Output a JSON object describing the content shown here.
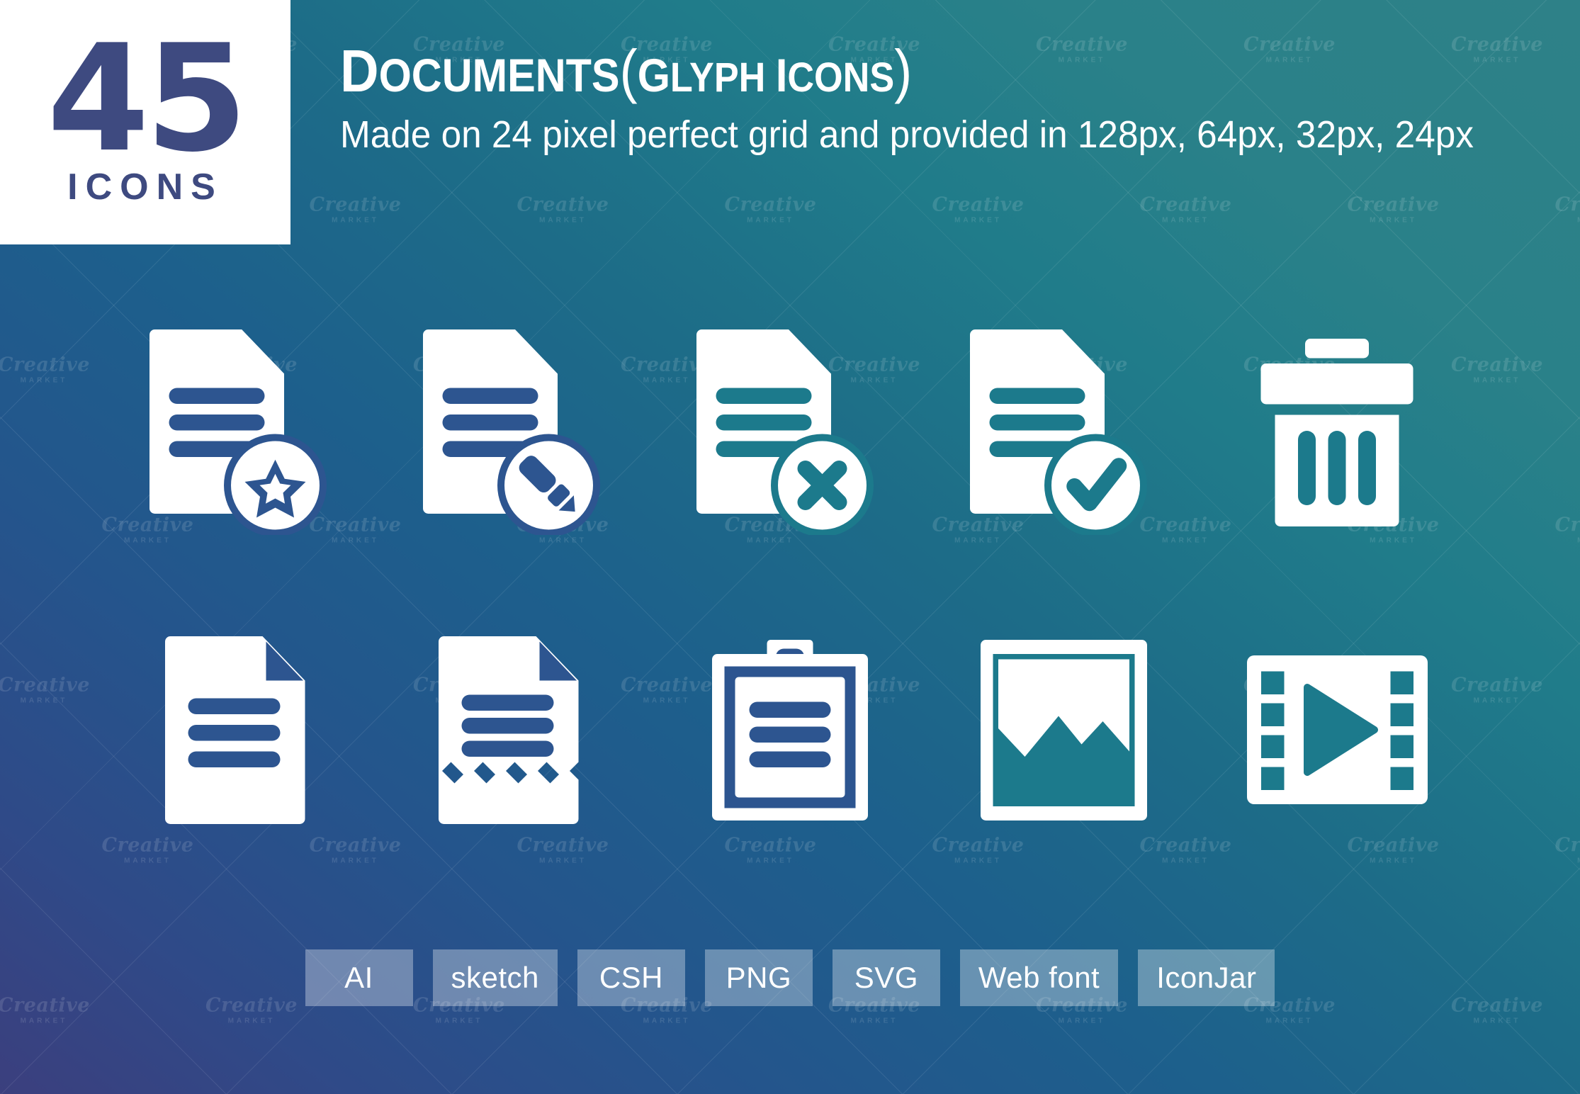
{
  "badge": {
    "count": "45",
    "word": "ICONS"
  },
  "header": {
    "title_lead": "D",
    "title_rest": "OCUMENTS",
    "title_paren_open": "(",
    "title_sub_lead": "G",
    "title_sub": "LYPH ",
    "title_sub_lead2": "I",
    "title_sub2": "CONS",
    "title_paren_close": ")",
    "title_plain": "Documents (Glyph Icons)",
    "subtitle": "Made on 24 pixel perfect grid and provided in 128px, 64px, 32px, 24px"
  },
  "icons": {
    "rows": [
      [
        {
          "name": "document-star-icon",
          "label": "Document Favorite"
        },
        {
          "name": "document-edit-icon",
          "label": "Document Edit"
        },
        {
          "name": "document-delete-icon",
          "label": "Document Remove"
        },
        {
          "name": "document-approved-icon",
          "label": "Document Approved"
        },
        {
          "name": "trash-bin-icon",
          "label": "Trash Bin"
        }
      ],
      [
        {
          "name": "document-plain-icon",
          "label": "Document"
        },
        {
          "name": "receipt-icon",
          "label": "Receipt"
        },
        {
          "name": "clipboard-icon",
          "label": "Clipboard"
        },
        {
          "name": "image-file-icon",
          "label": "Image File"
        },
        {
          "name": "video-file-icon",
          "label": "Video File"
        }
      ]
    ]
  },
  "formats": [
    {
      "label": "AI"
    },
    {
      "label": "sketch"
    },
    {
      "label": "CSH"
    },
    {
      "label": "PNG"
    },
    {
      "label": "SVG"
    },
    {
      "label": "Web font"
    },
    {
      "label": "IconJar"
    }
  ],
  "watermark": {
    "line1": "Creative",
    "line2": "MARKET"
  },
  "colors": {
    "brand_navy": "#3e4a80",
    "gradient_start": "#3b3f7e",
    "gradient_end": "#2e8188",
    "icon_fill": "#ffffff",
    "chip_fill": "rgba(255,255,255,0.33)"
  }
}
